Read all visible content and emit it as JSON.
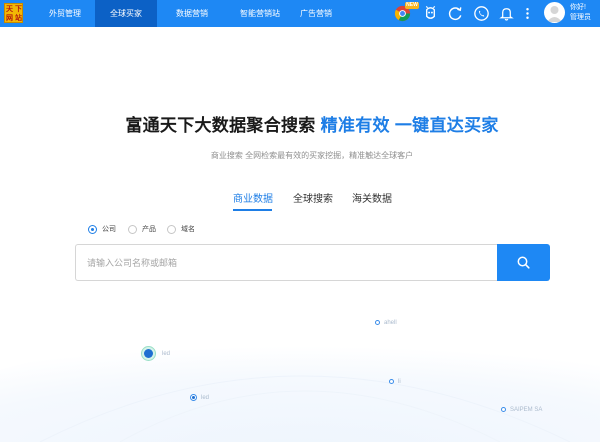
{
  "brand": {
    "logo_chars": [
      "天",
      "下",
      "网",
      "站"
    ]
  },
  "nav": {
    "items": [
      {
        "label": "外贸管理",
        "active": false
      },
      {
        "label": "全球买家",
        "active": true
      },
      {
        "label": "数据营销",
        "active": false
      },
      {
        "label": "智能营销站",
        "active": false
      },
      {
        "label": "广告营销",
        "active": false
      }
    ]
  },
  "toolbar": {
    "badge": "NEW",
    "icons": [
      "chrome-extension-icon",
      "ai-assistant-icon",
      "refresh-icon",
      "phone-icon",
      "bell-icon",
      "more-vertical-icon"
    ]
  },
  "user": {
    "greeting": "你好!",
    "role": "管理员"
  },
  "hero": {
    "title_main": "富通天下大数据聚合搜索",
    "title_accent": "精准有效 一键直达买家",
    "subtitle": "商业搜索 全网检索最有效的买家挖掘，精准触达全球客户"
  },
  "tabs": [
    {
      "label": "商业数据",
      "active": true
    },
    {
      "label": "全球搜索",
      "active": false
    },
    {
      "label": "海关数据",
      "active": false
    }
  ],
  "search_types": [
    {
      "label": "公司",
      "checked": true
    },
    {
      "label": "产品",
      "checked": false
    },
    {
      "label": "域名",
      "checked": false
    }
  ],
  "search": {
    "placeholder": "请输入公司名称或邮箱",
    "value": ""
  },
  "map_labels": {
    "a": "ahell",
    "b": "led",
    "c": "li",
    "d": "led",
    "e": "SAIPEM SA"
  },
  "colors": {
    "primary": "#1e88f4",
    "nav_active": "#0c61c6",
    "accent_text": "#1e7ee6"
  }
}
